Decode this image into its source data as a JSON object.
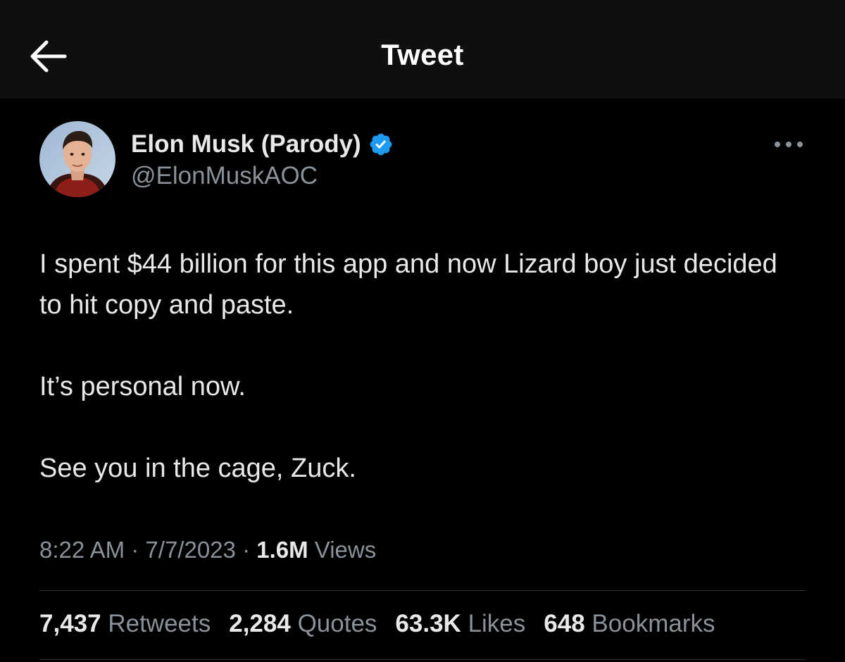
{
  "header": {
    "title": "Tweet",
    "back_icon": "arrow-left-icon"
  },
  "author": {
    "display_name": "Elon Musk (Parody)",
    "handle": "@ElonMuskAOC",
    "verified_icon": "verified-badge-icon",
    "verified_color": "#1d9bf0",
    "more_icon": "more-horizontal-icon"
  },
  "tweet": {
    "paragraphs": [
      "I spent $44 billion for this app and now Lizard boy just decided to hit copy and paste.",
      "It’s personal now.",
      "See you in the cage, Zuck."
    ]
  },
  "meta": {
    "time": "8:22 AM",
    "date": "7/7/2023",
    "views_count": "1.6M",
    "views_label": "Views",
    "separator": "·"
  },
  "stats": [
    {
      "count": "7,437",
      "label": "Retweets"
    },
    {
      "count": "2,284",
      "label": "Quotes"
    },
    {
      "count": "63.3K",
      "label": "Likes"
    },
    {
      "count": "648",
      "label": "Bookmarks"
    }
  ],
  "colors": {
    "background": "#000000",
    "topbar": "#0f0f0f",
    "text_primary": "#e7e9ea",
    "text_secondary": "#8b9198",
    "divider": "#2f3336"
  }
}
